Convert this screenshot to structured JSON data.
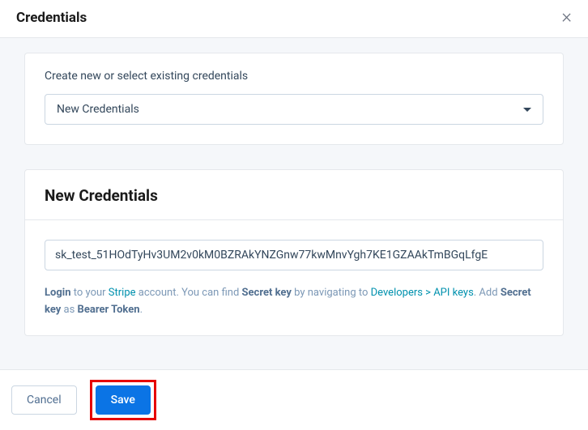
{
  "header": {
    "title": "Credentials"
  },
  "selectCard": {
    "label": "Create new or select existing credentials",
    "selectedValue": "New Credentials"
  },
  "credentialSection": {
    "title": "New Credentials",
    "inputValue": "sk_test_51HOdTyHv3UM2v0kM0BZRAkYNZGnw77kwMnvYgh7KE1GZAAkTmBGqLfgE",
    "helper": {
      "t1": "Login",
      "t2": " to your ",
      "linkStripe": "Stripe",
      "t3": " account. You can find ",
      "t4": "Secret key",
      "t5": " by navigating to ",
      "linkDevelopers": "Developers > API keys",
      "t6": ". Add ",
      "t7": "Secret key",
      "t8": " as ",
      "t9": "Bearer Token",
      "t10": "."
    }
  },
  "footer": {
    "cancelLabel": "Cancel",
    "saveLabel": "Save"
  }
}
